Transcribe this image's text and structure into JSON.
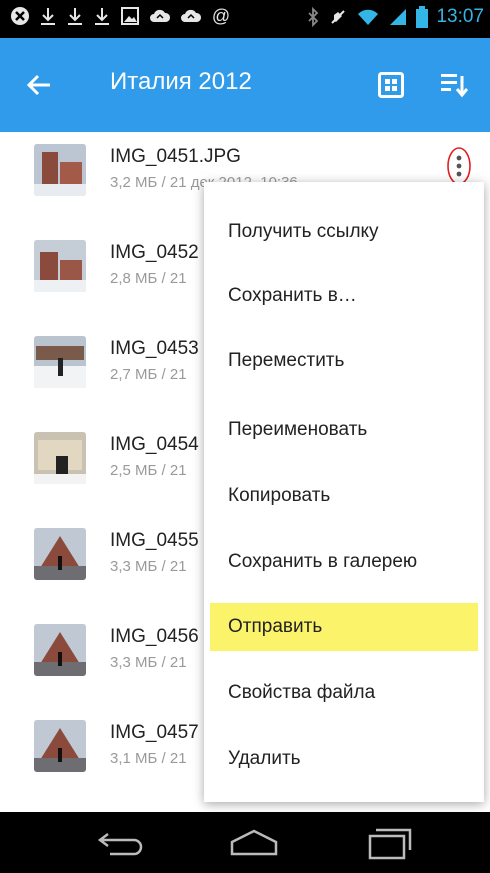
{
  "status_bar": {
    "time": "13:07",
    "left_icons": [
      "cancel-icon",
      "download-icon",
      "download-icon",
      "download-icon",
      "gallery-icon",
      "cloud-icon",
      "cloud-icon",
      "at-icon"
    ],
    "right_icons": [
      "bluetooth-icon",
      "mute-icon",
      "wifi-icon",
      "signal-icon",
      "battery-icon"
    ],
    "time_color": "#33b5e5"
  },
  "app_bar": {
    "title": "Италия 2012",
    "color": "#2f9bea"
  },
  "files": [
    {
      "name": "IMG_0451.JPG",
      "meta": "3,2 МБ / 21 дек 2012, 10:36"
    },
    {
      "name": "IMG_0452",
      "meta": "2,8 МБ / 21"
    },
    {
      "name": "IMG_0453",
      "meta": "2,7 МБ / 21"
    },
    {
      "name": "IMG_0454",
      "meta": "2,5 МБ / 21"
    },
    {
      "name": "IMG_0455",
      "meta": "3,3 МБ / 21"
    },
    {
      "name": "IMG_0456",
      "meta": "3,3 МБ / 21"
    },
    {
      "name": "IMG_0457",
      "meta": "3,1 МБ / 21"
    }
  ],
  "context_menu": {
    "items": [
      "Получить ссылку",
      "Сохранить в…",
      "Переместить",
      "Переименовать",
      "Копировать",
      "Сохранить в галерею",
      "Отправить",
      "Свойства файла",
      "Удалить"
    ],
    "highlighted": "Отправить",
    "highlight_color": "#fbf46a"
  },
  "nav_bar": {
    "icons": [
      "back-icon",
      "home-icon",
      "recents-icon"
    ]
  }
}
